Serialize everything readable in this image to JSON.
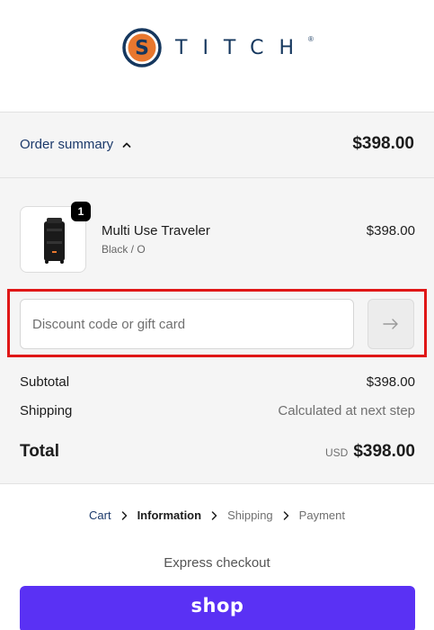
{
  "brand": {
    "name": "STITCH",
    "registered_mark": "®",
    "logo_letter": "S"
  },
  "summary_toggle": {
    "label": "Order summary",
    "total": "$398.00"
  },
  "line_items": [
    {
      "name": "Multi Use Traveler",
      "variant": "Black / O",
      "price": "$398.00",
      "quantity": "1"
    }
  ],
  "discount": {
    "placeholder": "Discount code or gift card",
    "value": ""
  },
  "totals": {
    "subtotal_label": "Subtotal",
    "subtotal_value": "$398.00",
    "shipping_label": "Shipping",
    "shipping_value": "Calculated at next step",
    "total_label": "Total",
    "currency": "USD",
    "total_value": "$398.00"
  },
  "breadcrumb": [
    {
      "label": "Cart",
      "state": "link"
    },
    {
      "label": "Information",
      "state": "current"
    },
    {
      "label": "Shipping",
      "state": "upcoming"
    },
    {
      "label": "Payment",
      "state": "upcoming"
    }
  ],
  "express": {
    "label": "Express checkout",
    "shop_button": "shop"
  },
  "colors": {
    "brand_orange": "#e8772e",
    "brand_navy": "#15375e",
    "shop_purple": "#5a31f4",
    "highlight_red": "#e01717"
  }
}
